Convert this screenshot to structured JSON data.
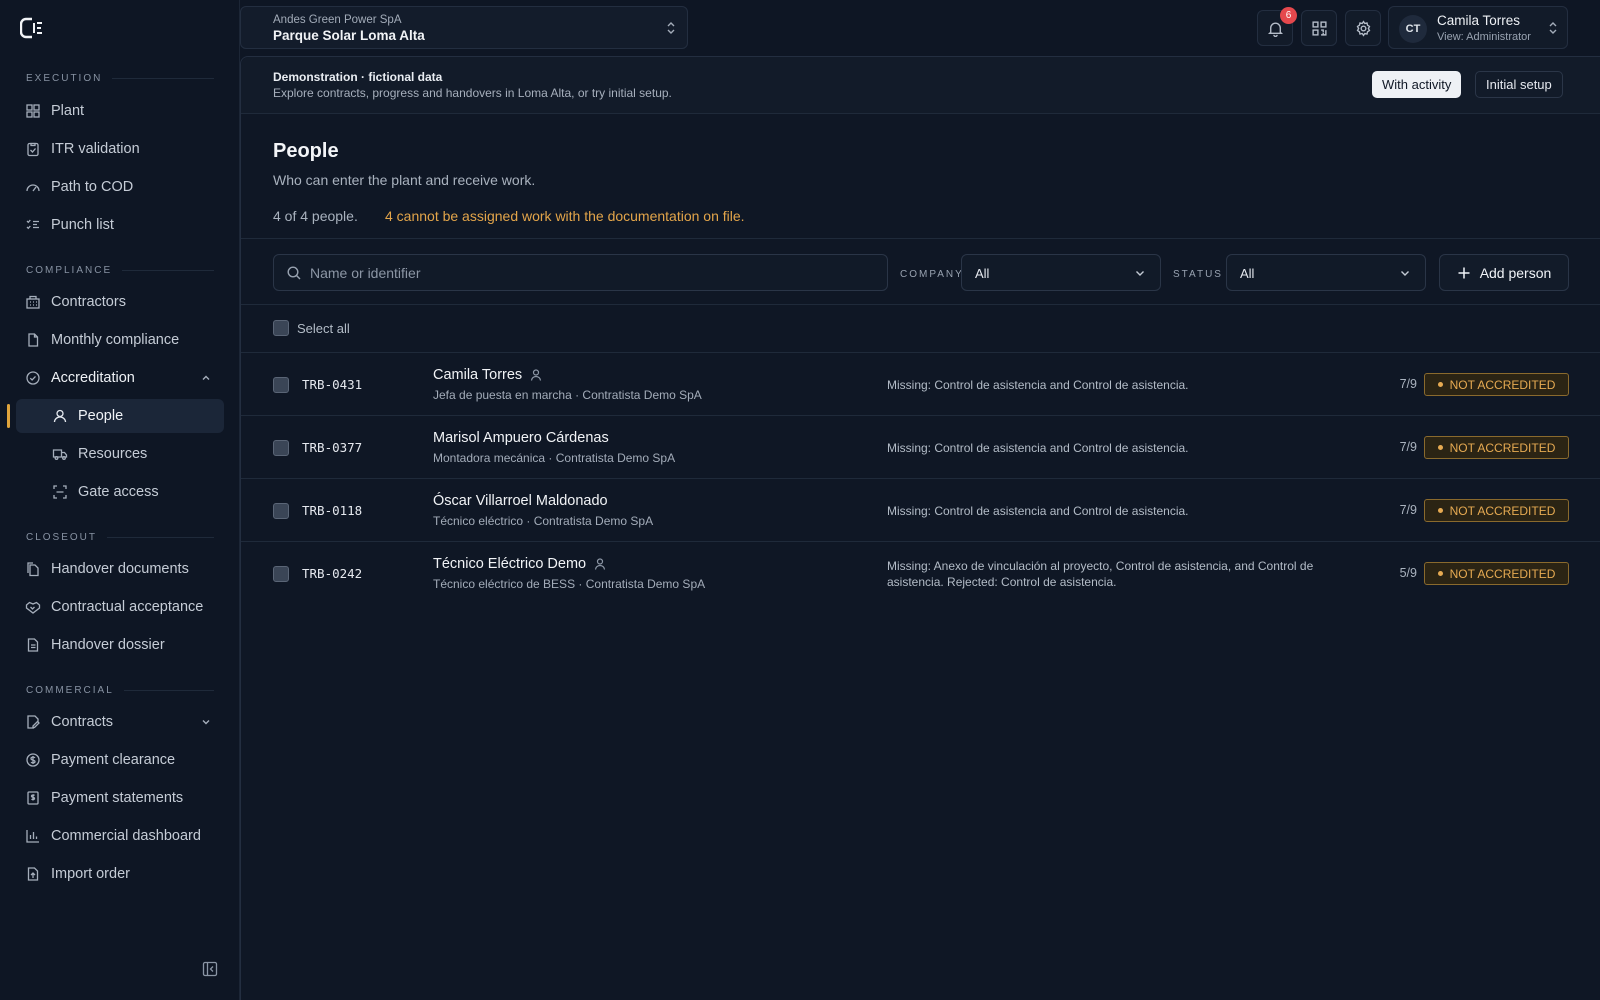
{
  "sidebar": {
    "sections": {
      "execution": "EXECUTION",
      "compliance": "COMPLIANCE",
      "closeout": "CLOSEOUT",
      "commercial": "COMMERCIAL"
    },
    "items": {
      "plant": "Plant",
      "itr": "ITR validation",
      "path_cod": "Path to COD",
      "punch": "Punch list",
      "contractors": "Contractors",
      "monthly": "Monthly compliance",
      "accreditation": "Accreditation",
      "people": "People",
      "resources": "Resources",
      "gate": "Gate access",
      "handover_docs": "Handover documents",
      "contractual": "Contractual acceptance",
      "dossier": "Handover dossier",
      "contracts": "Contracts",
      "payment_clearance": "Payment clearance",
      "payment_statements": "Payment statements",
      "commercial_dashboard": "Commercial dashboard",
      "import_order": "Import order"
    }
  },
  "topbar": {
    "org": "Andes Green Power SpA",
    "project": "Parque Solar Loma Alta",
    "notifications_count": "6",
    "user_initials": "CT",
    "user_name": "Camila Torres",
    "user_role": "View: Administrator"
  },
  "banner": {
    "title": "Demonstration · fictional data",
    "subtitle": "Explore contracts, progress and handovers in Loma Alta, or try initial setup.",
    "with_activity": "With activity",
    "initial_setup": "Initial setup"
  },
  "page": {
    "title": "People",
    "subtitle": "Who can enter the plant and receive work.",
    "count": "4 of 4 people.",
    "warning": "4 cannot be assigned work with the documentation on file."
  },
  "filters": {
    "search_placeholder": "Name or identifier",
    "company_label": "COMPANY",
    "company_value": "All",
    "status_label": "STATUS",
    "status_value": "All",
    "add_person": "Add person",
    "select_all": "Select all"
  },
  "people": [
    {
      "id": "TRB-0431",
      "name": "Camila Torres",
      "meta": "Jefa de puesta en marcha · Contratista Demo SpA",
      "missing": "Missing: Control de asistencia and Control de asistencia.",
      "score": "7/9",
      "status": "NOT ACCREDITED"
    },
    {
      "id": "TRB-0377",
      "name": "Marisol Ampuero Cárdenas",
      "meta": "Montadora mecánica · Contratista Demo SpA",
      "missing": "Missing: Control de asistencia and Control de asistencia.",
      "score": "7/9",
      "status": "NOT ACCREDITED"
    },
    {
      "id": "TRB-0118",
      "name": "Óscar Villarroel Maldonado",
      "meta": "Técnico eléctrico · Contratista Demo SpA",
      "missing": "Missing: Control de asistencia and Control de asistencia.",
      "score": "7/9",
      "status": "NOT ACCREDITED"
    },
    {
      "id": "TRB-0242",
      "name": "Técnico Eléctrico Demo",
      "meta": "Técnico eléctrico de BESS · Contratista Demo SpA",
      "missing": "Missing: Anexo de vinculación al proyecto, Control de asistencia, and Control de asistencia. Rejected: Control de asistencia.",
      "score": "5/9",
      "status": "NOT ACCREDITED"
    }
  ],
  "colors": {
    "accent": "#e0a43c",
    "warning_text": "#e3a54a",
    "badge_red": "#e5484d",
    "background": "#0e1624"
  }
}
